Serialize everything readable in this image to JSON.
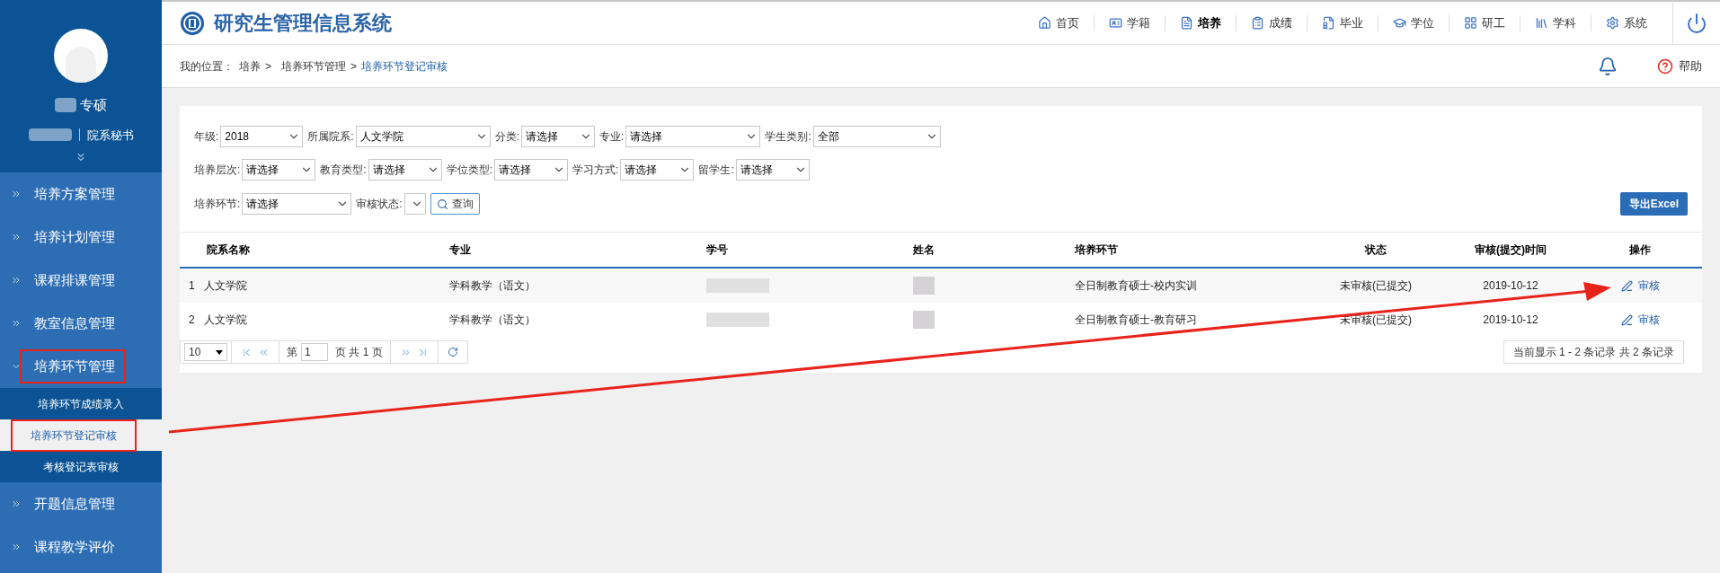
{
  "sidebar": {
    "user": {
      "name": "专硕",
      "role": "院系秘书"
    },
    "menu": [
      {
        "label": "培养方案管理",
        "expanded": false,
        "annotated": false
      },
      {
        "label": "培养计划管理",
        "expanded": false,
        "annotated": false
      },
      {
        "label": "课程排课管理",
        "expanded": false,
        "annotated": false
      },
      {
        "label": "教室信息管理",
        "expanded": false,
        "annotated": false
      },
      {
        "label": "培养环节管理",
        "expanded": true,
        "annotated": true,
        "children": [
          {
            "label": "培养环节成绩录入",
            "selected": false,
            "annotated": false
          },
          {
            "label": "培养环节登记审核",
            "selected": true,
            "annotated": true
          },
          {
            "label": "考核登记表审核",
            "selected": false,
            "annotated": false
          }
        ]
      },
      {
        "label": "开题信息管理",
        "expanded": false,
        "annotated": false
      },
      {
        "label": "课程教学评价",
        "expanded": false,
        "annotated": false
      }
    ]
  },
  "header": {
    "title": "研究生管理信息系统",
    "nav": [
      {
        "kind": "home",
        "label": "首页",
        "selected": false
      },
      {
        "kind": "card",
        "label": "学籍",
        "selected": false
      },
      {
        "kind": "doc",
        "label": "培养",
        "selected": true
      },
      {
        "kind": "sheet",
        "label": "成绩",
        "selected": false
      },
      {
        "kind": "cert",
        "label": "毕业",
        "selected": false
      },
      {
        "kind": "cap",
        "label": "学位",
        "selected": false
      },
      {
        "kind": "grid",
        "label": "研工",
        "selected": false
      },
      {
        "kind": "books",
        "label": "学科",
        "selected": false
      },
      {
        "kind": "gear",
        "label": "系统",
        "selected": false
      }
    ]
  },
  "breadcrumb": {
    "label": "我的位置：",
    "separator": ">",
    "path": [
      "培养",
      "培养环节管理"
    ],
    "current": "培养环节登记审核",
    "help": "帮助"
  },
  "filters": [
    [
      {
        "label": "年级:",
        "value": "2018"
      },
      {
        "label": "所属院系:",
        "value": "人文学院"
      },
      {
        "label": "分类:",
        "value": "请选择"
      },
      {
        "label": "专业:",
        "value": "请选择"
      },
      {
        "label": "学生类别:",
        "value": "全部"
      }
    ],
    [
      {
        "label": "培养层次:",
        "value": "请选择"
      },
      {
        "label": "教育类型:",
        "value": "请选择"
      },
      {
        "label": "学位类型:",
        "value": "请选择"
      },
      {
        "label": "学习方式:",
        "value": "请选择"
      },
      {
        "label": "留学生:",
        "value": "请选择"
      }
    ],
    [
      {
        "label": "培养环节:",
        "value": "请选择"
      },
      {
        "label": "审核状态:"
      }
    ]
  ],
  "query_button": "查询",
  "export_button": "导出Excel",
  "table": {
    "columns": [
      "院系名称",
      "专业",
      "学号",
      "姓名",
      "培养环节",
      "状态",
      "审核(提交)时间",
      "操作"
    ],
    "rows": [
      {
        "index": "1",
        "dept": "人文学院",
        "major": "学科教学（语文）",
        "stage": "全日制教育硕士-校内实训",
        "status": "未审核(已提交)",
        "time": "2019-10-12",
        "action": "审核"
      },
      {
        "index": "2",
        "dept": "人文学院",
        "major": "学科教学（语文）",
        "stage": "全日制教育硕士-教育研习",
        "status": "未审核(已提交)",
        "time": "2019-10-12",
        "action": "审核"
      }
    ]
  },
  "pagination": {
    "page_size": "10",
    "page_prefix": "第",
    "page": "1",
    "page_suffix": "页 共 1 页",
    "summary": "当前显示 1 - 2 条记录 共 2 条记录"
  }
}
